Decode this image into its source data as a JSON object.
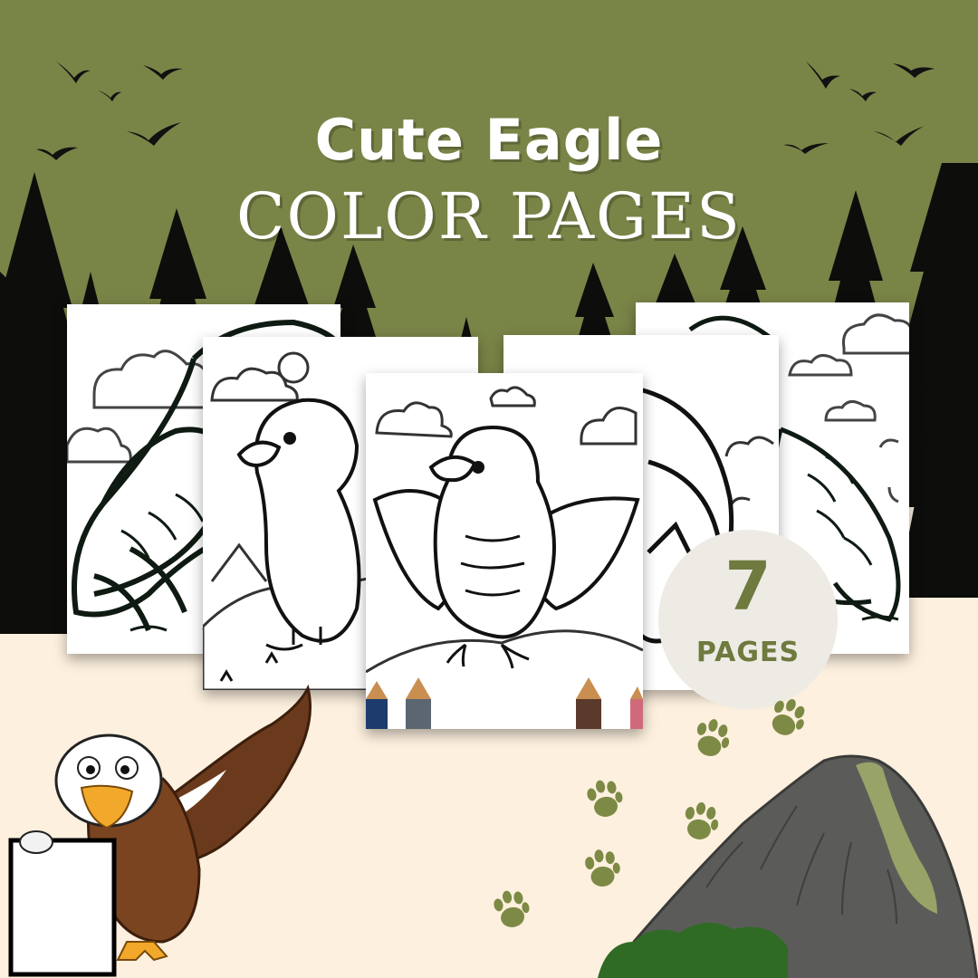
{
  "title": {
    "line1": "Cute Eagle",
    "line2": "COLOR PAGES"
  },
  "badge": {
    "count": "7",
    "label": "PAGES"
  },
  "colors": {
    "olive_band": "#798447",
    "sand_ground": "#fdf0de",
    "tree_silhouette": "#0d0d0b",
    "badge_background": "#eeebe5",
    "badge_text": "#6e7a3e",
    "paw_print": "#7d8a45",
    "mountain_gray": "#5b5c59",
    "mountain_moss": "#98a368"
  },
  "preview_pages": [
    {
      "name": "preview-page-eagle-closeup"
    },
    {
      "name": "preview-page-eagle-perched"
    },
    {
      "name": "preview-page-eagle-wings-spread"
    },
    {
      "name": "preview-page-eagle-sitting"
    },
    {
      "name": "preview-page-eagle-side"
    }
  ],
  "decorations": [
    "flying-birds-icon",
    "pine-tree-icon",
    "paw-print-icon",
    "mountain-icon",
    "cartoon-eagle-mascot",
    "colored-pencil-icon"
  ]
}
